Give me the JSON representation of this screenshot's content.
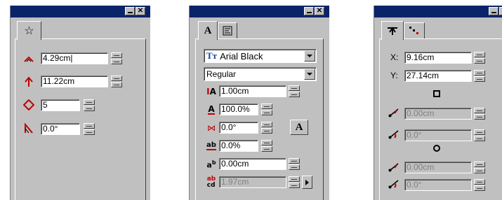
{
  "panel1": {
    "fields": [
      {
        "value": "4.29cm|"
      },
      {
        "value": "11.22cm"
      },
      {
        "value": "5"
      },
      {
        "value": "0.0°"
      }
    ]
  },
  "panel2": {
    "tab_a_label": "A",
    "font_name": "Arial Black",
    "font_style": "Regular",
    "fields": [
      {
        "value": "1.00cm"
      },
      {
        "value": "100.0%"
      },
      {
        "value": "0.0°"
      },
      {
        "value": "0.0%"
      },
      {
        "value": "0.00cm"
      },
      {
        "value": "1.97cm"
      }
    ],
    "char_button_label": "A"
  },
  "panel3": {
    "x_label": "X:",
    "x_value": "9.16cm",
    "y_label": "Y:",
    "y_value": "27.14cm",
    "square_fields": [
      {
        "value": "0.00cm"
      },
      {
        "value": "0.0°"
      }
    ],
    "circle_fields": [
      {
        "value": "0.00cm"
      },
      {
        "value": "0.0°"
      }
    ]
  }
}
